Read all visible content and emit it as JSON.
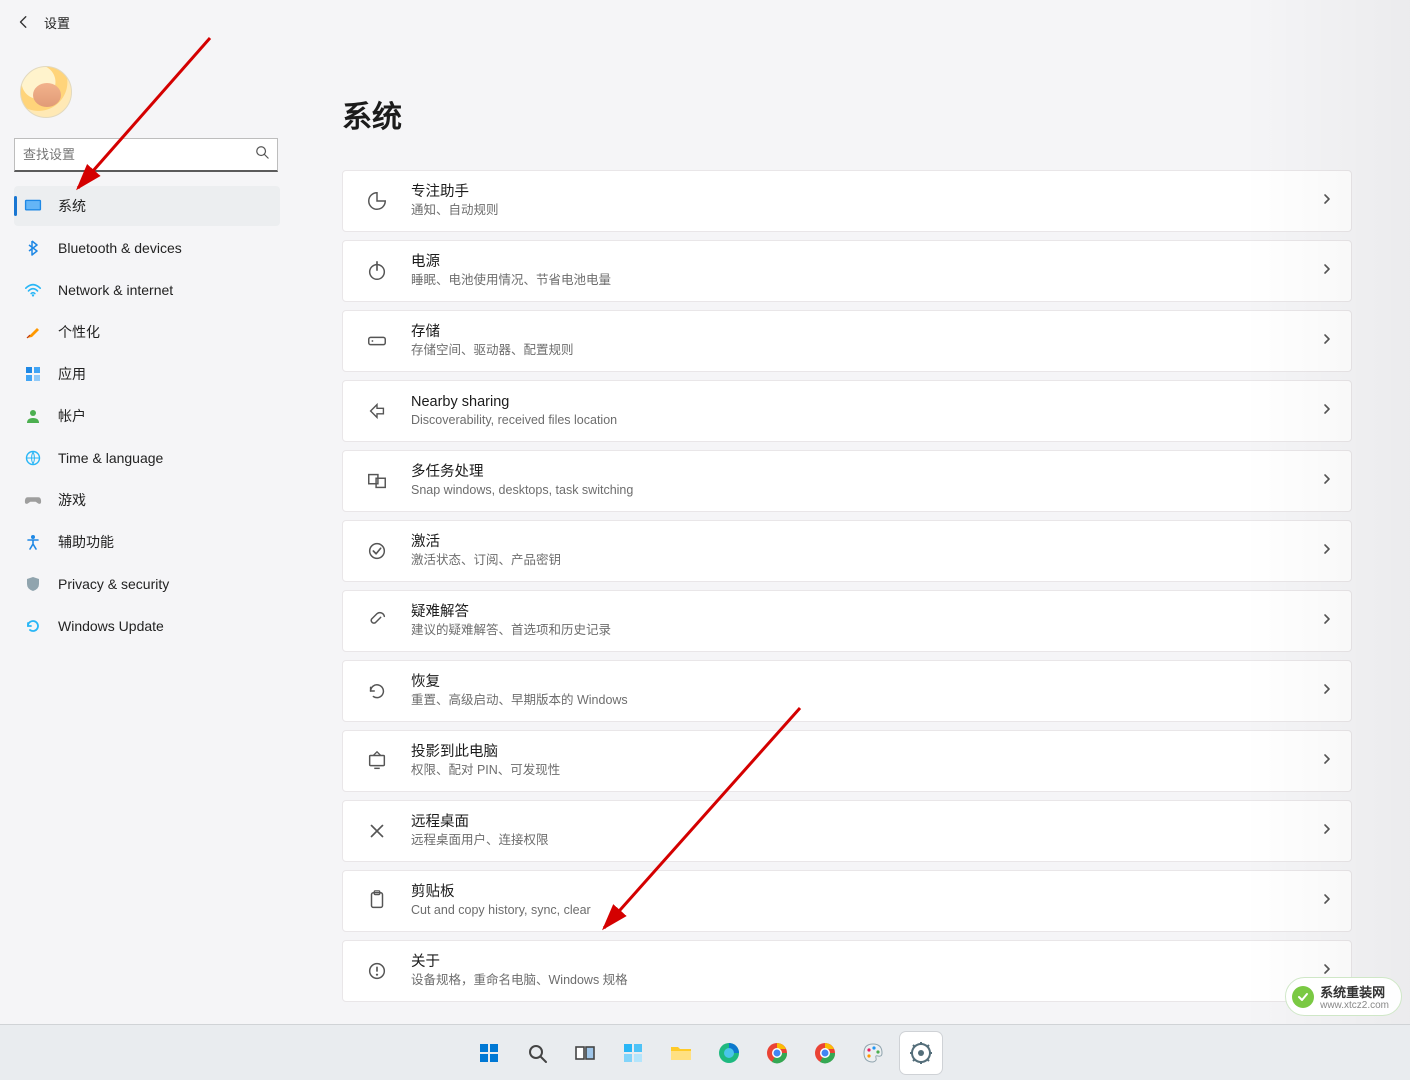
{
  "app": {
    "title": "设置"
  },
  "search": {
    "placeholder": "查找设置"
  },
  "sidebar": {
    "items": [
      {
        "label": "系统"
      },
      {
        "label": "Bluetooth & devices"
      },
      {
        "label": "Network & internet"
      },
      {
        "label": "个性化"
      },
      {
        "label": "应用"
      },
      {
        "label": "帐户"
      },
      {
        "label": "Time & language"
      },
      {
        "label": "游戏"
      },
      {
        "label": "辅助功能"
      },
      {
        "label": "Privacy & security"
      },
      {
        "label": "Windows Update"
      }
    ]
  },
  "page": {
    "title": "系统"
  },
  "cards": [
    {
      "title": "专注助手",
      "sub": "通知、自动规则"
    },
    {
      "title": "电源",
      "sub": "睡眠、电池使用情况、节省电池电量"
    },
    {
      "title": "存储",
      "sub": "存储空间、驱动器、配置规则"
    },
    {
      "title": "Nearby sharing",
      "sub": "Discoverability, received files location"
    },
    {
      "title": "多任务处理",
      "sub": "Snap windows, desktops, task switching"
    },
    {
      "title": "激活",
      "sub": "激活状态、订阅、产品密钥"
    },
    {
      "title": "疑难解答",
      "sub": "建议的疑难解答、首选项和历史记录"
    },
    {
      "title": "恢复",
      "sub": "重置、高级启动、早期版本的 Windows"
    },
    {
      "title": "投影到此电脑",
      "sub": "权限、配对 PIN、可发现性"
    },
    {
      "title": "远程桌面",
      "sub": "远程桌面用户、连接权限"
    },
    {
      "title": "剪贴板",
      "sub": "Cut and copy history, sync, clear"
    },
    {
      "title": "关于",
      "sub": "设备规格，重命名电脑、Windows 规格"
    }
  ],
  "watermark": {
    "text": "系统重装网",
    "url": "www.xtcz2.com"
  }
}
